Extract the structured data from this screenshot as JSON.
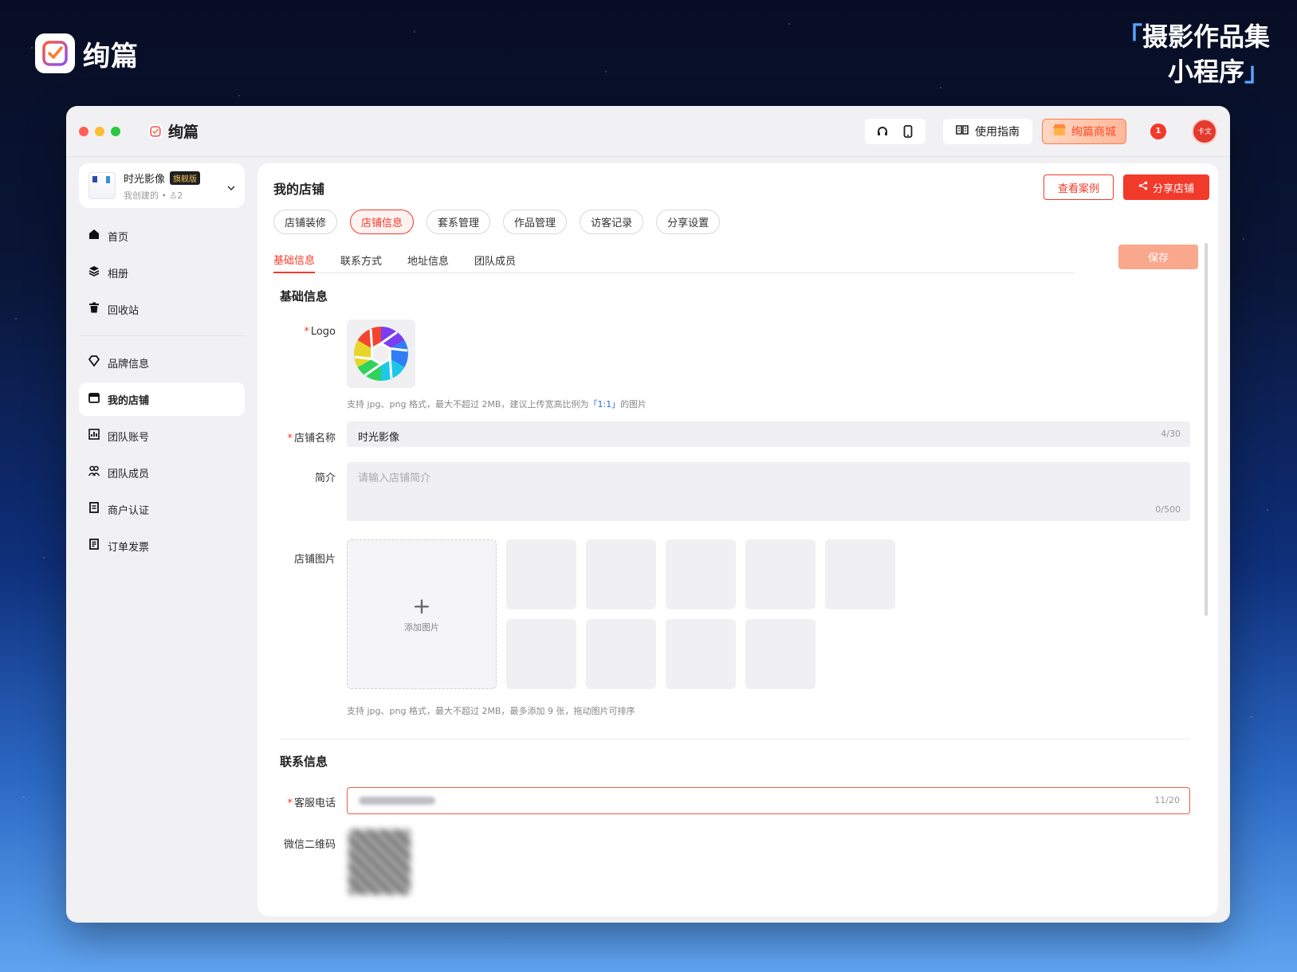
{
  "brand": {
    "name": "绚篇",
    "icon": "check-square-icon"
  },
  "slogan": {
    "open_quote": "「",
    "line1": "摄影作品集",
    "line2": "小程序",
    "close_quote": "」"
  },
  "window": {
    "app_name": "绚篇"
  },
  "toolbar": {
    "headset_icon": "headset-icon",
    "phone_icon": "phone-icon",
    "guide_label": "使用指南",
    "store_label": "绚篇商城",
    "notification_count": "1",
    "avatar_text": "卡文"
  },
  "workspace": {
    "name": "时光影像",
    "badge": "旗舰版",
    "sub": "我创建的 • ♙2"
  },
  "sidebar": {
    "items": [
      {
        "label": "首页",
        "icon": "home-icon"
      },
      {
        "label": "相册",
        "icon": "layers-icon"
      },
      {
        "label": "回收站",
        "icon": "trash-icon"
      },
      {
        "label": "品牌信息",
        "icon": "diamond-icon"
      },
      {
        "label": "我的店铺",
        "icon": "shop-icon"
      },
      {
        "label": "团队账号",
        "icon": "chart-icon"
      },
      {
        "label": "团队成员",
        "icon": "team-icon"
      },
      {
        "label": "商户认证",
        "icon": "doc-icon"
      },
      {
        "label": "订单发票",
        "icon": "invoice-icon"
      }
    ]
  },
  "main": {
    "title": "我的店铺",
    "view_case": "查看案例",
    "share_store": "分享店铺",
    "pills": [
      "店铺装修",
      "店铺信息",
      "套系管理",
      "作品管理",
      "访客记录",
      "分享设置"
    ],
    "subtabs": [
      "基础信息",
      "联系方式",
      "地址信息",
      "团队成员"
    ],
    "save": "保存"
  },
  "form": {
    "basic_title": "基础信息",
    "req_mark": "*",
    "logo_label": "Logo",
    "logo_hint_pre": "支持 jpg、png 格式，最大不超过 2MB，建议上传宽高比例为",
    "logo_hint_ratio": "「1:1」",
    "logo_hint_post": "的图片",
    "store_name_label": "店铺名称",
    "store_name_value": "时光影像",
    "store_name_count": "4/30",
    "intro_label": "简介",
    "intro_placeholder": "请输入店铺简介",
    "intro_count": "0/500",
    "images_label": "店铺图片",
    "add_image": "添加图片",
    "images_hint": "支持 jpg、png 格式，最大不超过 2MB，最多添加 9 张，拖动图片可排序",
    "contact_title": "联系信息",
    "phone_label": "客服电话",
    "phone_count": "11/20",
    "wechat_label": "微信二维码"
  }
}
